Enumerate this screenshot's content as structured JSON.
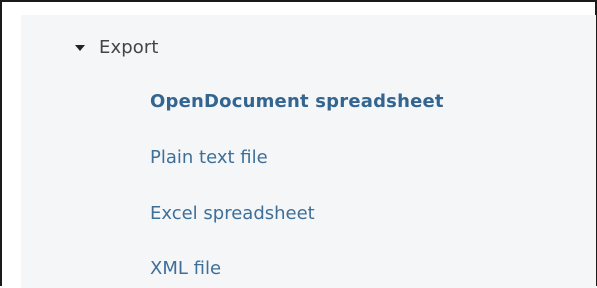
{
  "export_menu": {
    "section_label": "Export",
    "expanded": true,
    "items": [
      {
        "label": "OpenDocument spreadsheet",
        "selected": true
      },
      {
        "label": "Plain text file",
        "selected": false
      },
      {
        "label": "Excel spreadsheet",
        "selected": false
      },
      {
        "label": "XML file",
        "selected": false
      }
    ]
  },
  "icons": {
    "section_toggle": "caret-down-icon"
  },
  "colors": {
    "panel_background": "#f5f6f8",
    "link": "#3e6f99",
    "link_selected": "#336591",
    "section_text": "#444444",
    "frame_border": "#1a1a1a"
  }
}
